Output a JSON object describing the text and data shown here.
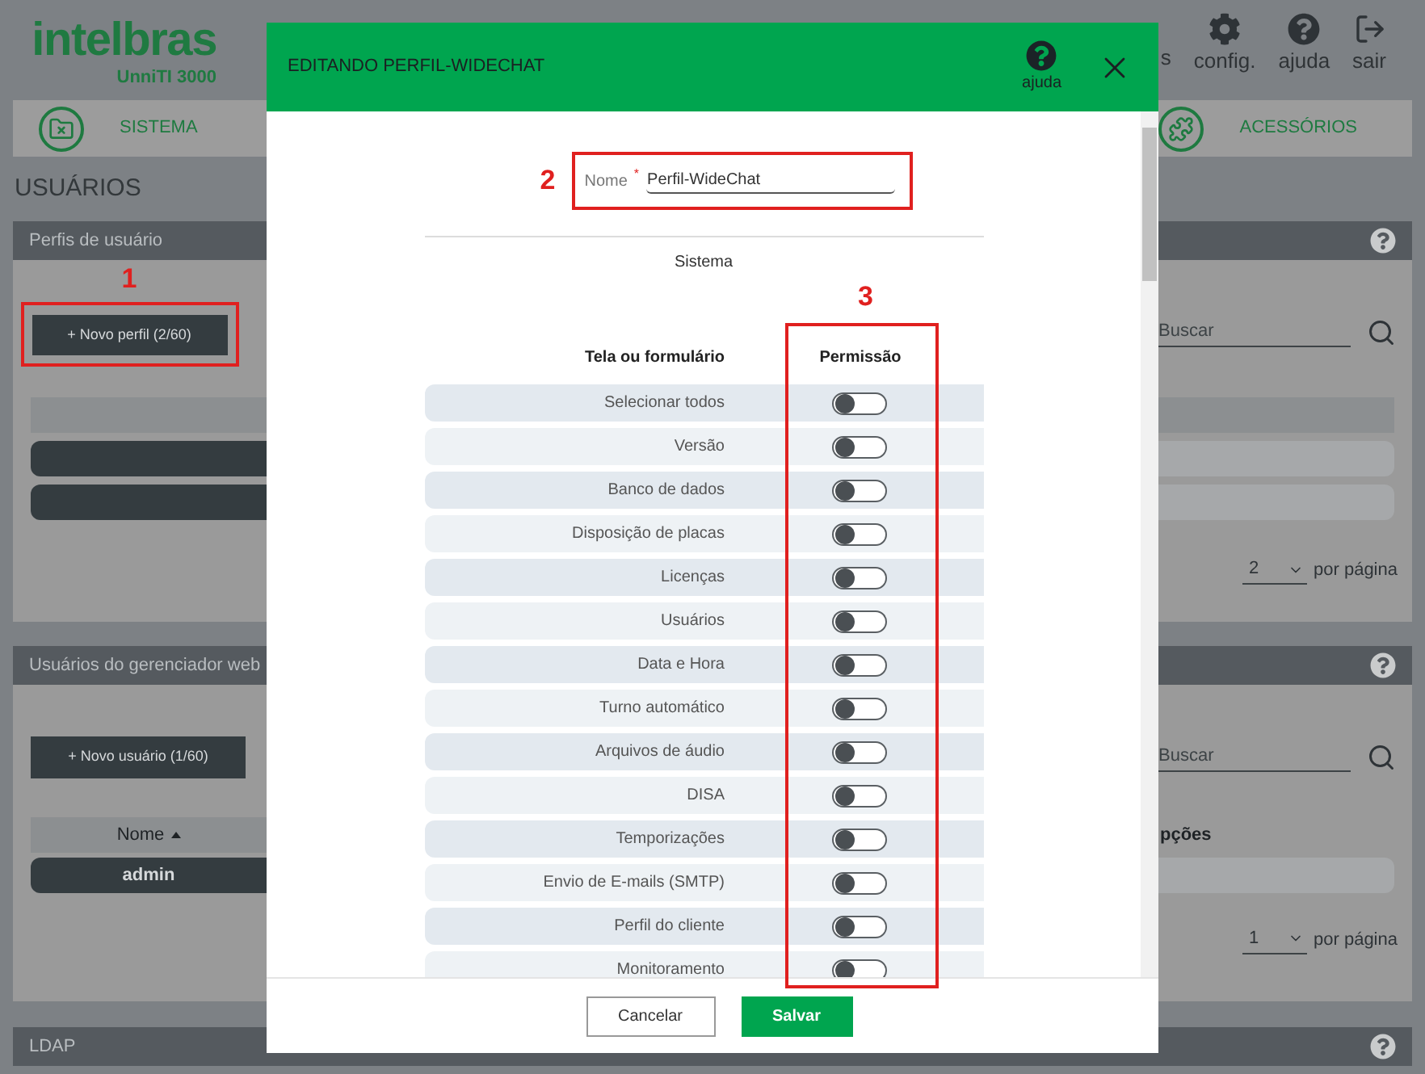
{
  "header": {
    "logo": "intelbras",
    "product": "UnniTI 3000",
    "cut_item": "s",
    "actions": [
      {
        "kind": "settings",
        "label": "config."
      },
      {
        "kind": "help",
        "label": "ajuda"
      },
      {
        "kind": "exit",
        "label": "sair"
      }
    ]
  },
  "nav": [
    {
      "kind": "folder",
      "label": "SISTEMA"
    },
    {
      "kind": "puzzle",
      "label": "ACESSÓRIOS"
    }
  ],
  "page_title": "USUÁRIOS",
  "profiles_panel": {
    "title": "Perfis de usuário",
    "annotation": "1",
    "new_button": "+ Novo perfil (2/60)",
    "search_placeholder": "Buscar",
    "page_size": "2",
    "per_page": "por página"
  },
  "users_panel": {
    "title": "Usuários do gerenciador web",
    "new_button": "+ Novo usuário (1/60)",
    "search_placeholder": "Buscar",
    "column_1": "Nome",
    "column_2": "pções",
    "rows": [
      "admin"
    ],
    "page_size": "1",
    "per_page": "por página"
  },
  "ldap_panel": {
    "title": "LDAP"
  },
  "modal": {
    "title": "EDITANDO PERFIL-WIDECHAT",
    "help": "ajuda",
    "name_annotation": "2",
    "name_label": "Nome",
    "required_mark": "*",
    "name_value": "Perfil-WideChat",
    "section": "Sistema",
    "permission_annotation": "3",
    "columns": [
      "Tela ou formulário",
      "Permissão"
    ],
    "rows": [
      {
        "label": "Selecionar todos",
        "on": false
      },
      {
        "label": "Versão",
        "on": false
      },
      {
        "label": "Banco de dados",
        "on": false
      },
      {
        "label": "Disposição de placas",
        "on": false
      },
      {
        "label": "Licenças",
        "on": false
      },
      {
        "label": "Usuários",
        "on": false
      },
      {
        "label": "Data e Hora",
        "on": false
      },
      {
        "label": "Turno automático",
        "on": false
      },
      {
        "label": "Arquivos de áudio",
        "on": false
      },
      {
        "label": "DISA",
        "on": false
      },
      {
        "label": "Temporizações",
        "on": false
      },
      {
        "label": "Envio de E-mails (SMTP)",
        "on": false
      },
      {
        "label": "Perfil do cliente",
        "on": false
      },
      {
        "label": "Monitoramento",
        "on": false
      }
    ],
    "buttons": {
      "cancel": "Cancelar",
      "save": "Salvar"
    }
  }
}
